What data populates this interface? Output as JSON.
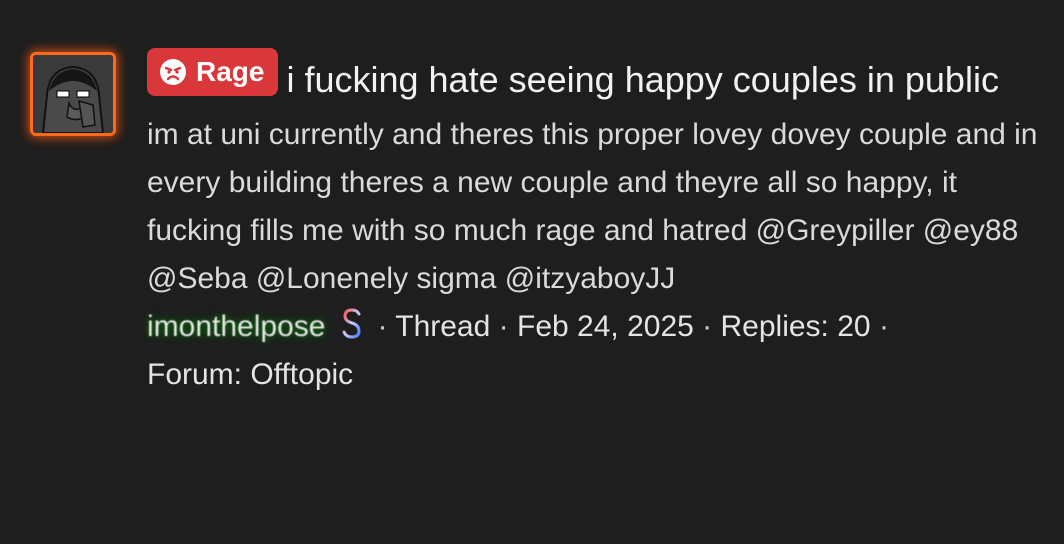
{
  "thread": {
    "prefix": {
      "label": "Rage",
      "icon": "angry-face-icon",
      "color": "#d9373a"
    },
    "title": "i fucking hate seeing happy couples in public",
    "snippet": "im at uni currently and theres this proper lovey dovey couple and in every building theres a new couple and theyre all so happy, it fucking fills me with so much rage and hatred @Greypiller @ey88 @Seba @Lonenely sigma @itzyaboyJJ",
    "author": "imonthelpose",
    "author_badge_icon": "dollar-sign-icon",
    "type": "Thread",
    "date": "Feb 24, 2025",
    "replies_label": "Replies: 20",
    "forum_label": "Forum: Offtopic",
    "separator": "·",
    "avatar_icon": "wojak-avatar-icon",
    "accent_colors": {
      "avatar_glow": "#ff6a1a",
      "author_name": "#178a17",
      "background": "#1e1e1e"
    }
  }
}
